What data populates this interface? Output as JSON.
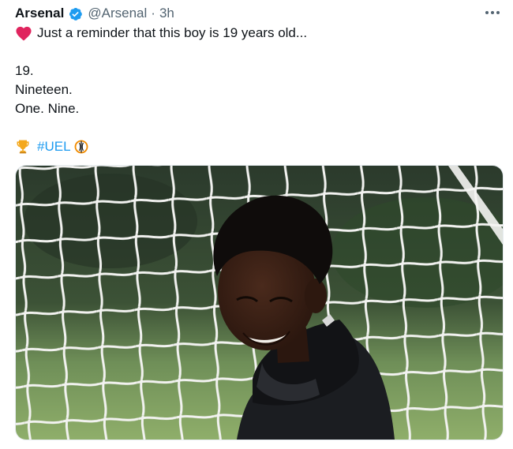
{
  "tweet": {
    "author_name": "Arsenal",
    "handle": "@Arsenal",
    "separator": "·",
    "time": "3h",
    "lines": [
      "Just a reminder that this boy is 19 years old...",
      "19.",
      "Nineteen.",
      "One. Nine."
    ],
    "hashtag": "#UEL"
  },
  "icons": {
    "verified": "verified-badge-icon",
    "more": "more-options-icon",
    "heart": "red-heart-emoji-icon",
    "trophy": "trophy-emoji-icon",
    "uel": "europa-league-logo-icon"
  },
  "colors": {
    "text": "#0f1419",
    "secondary": "#536471",
    "link": "#1d9bf0",
    "verified": "#1d9bf0",
    "heart": "#e0245e"
  }
}
